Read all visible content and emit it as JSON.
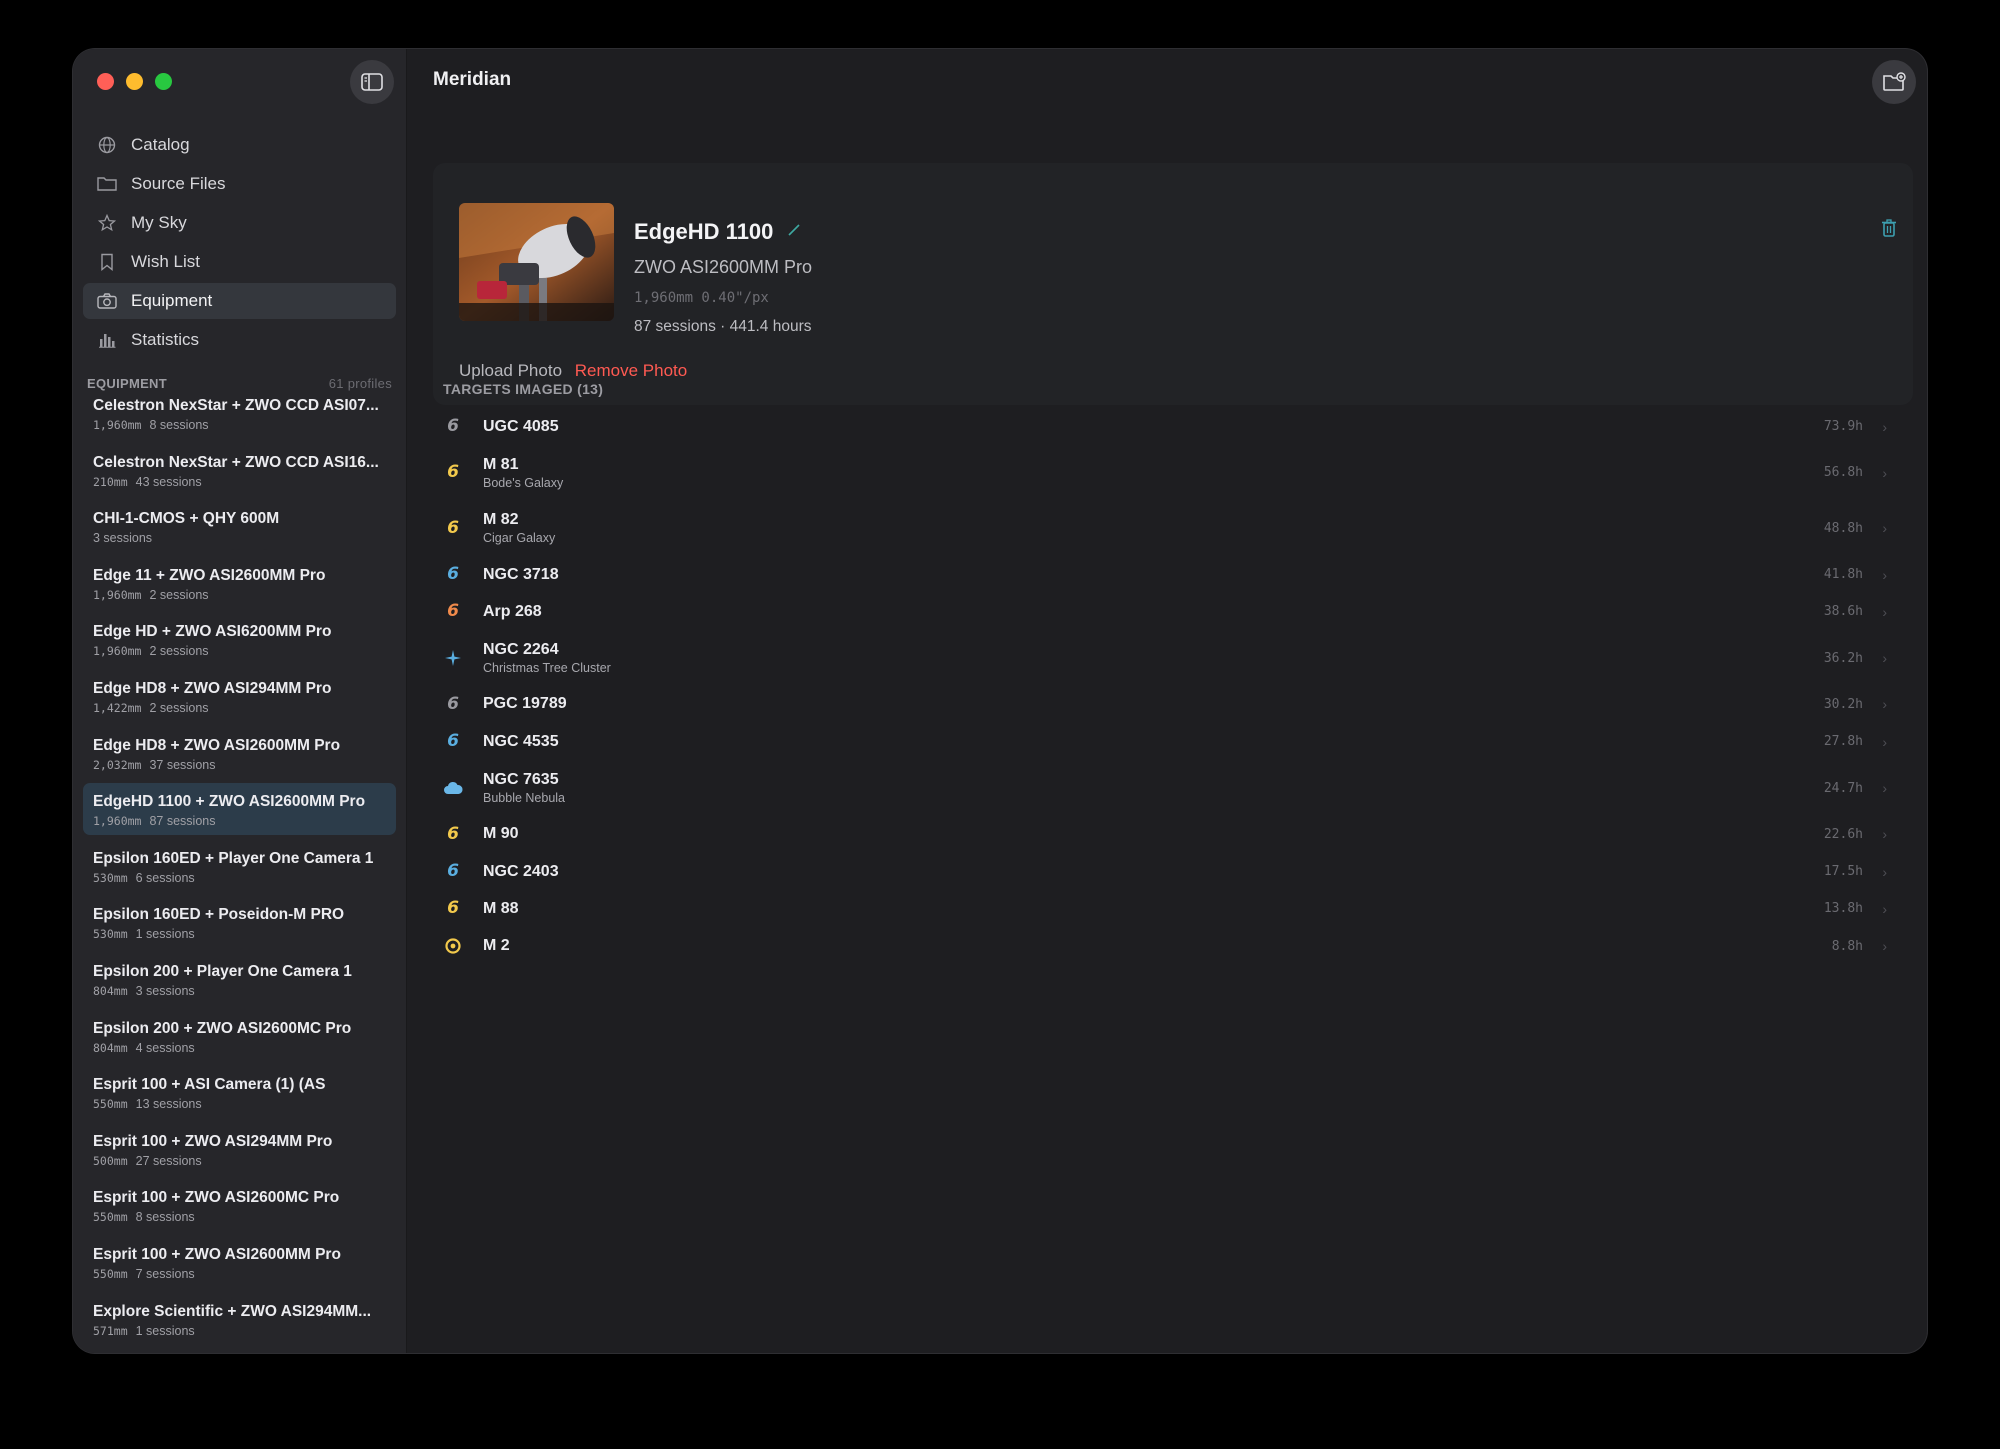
{
  "window": {
    "title": "Meridian"
  },
  "colors": {
    "accent_teal": "#3fa9a1",
    "danger": "#ff5a52",
    "selection": "#2c3c4a"
  },
  "nav": [
    {
      "label": "Catalog",
      "icon": "globe-icon"
    },
    {
      "label": "Source Files",
      "icon": "folder-icon"
    },
    {
      "label": "My Sky",
      "icon": "star-icon"
    },
    {
      "label": "Wish List",
      "icon": "bookmark-icon"
    },
    {
      "label": "Equipment",
      "icon": "camera-icon",
      "active": true
    },
    {
      "label": "Statistics",
      "icon": "bar-chart-icon"
    }
  ],
  "equipment_section": {
    "label": "EQUIPMENT",
    "count": "61 profiles"
  },
  "equipment": [
    {
      "name": "Celestron NexStar + ZWO CCD ASI07...",
      "focal": "1,960mm",
      "sessions": "8 sessions"
    },
    {
      "name": "Celestron NexStar + ZWO CCD ASI16...",
      "focal": "210mm",
      "sessions": "43 sessions"
    },
    {
      "name": "CHI-1-CMOS + QHY 600M",
      "focal": "",
      "sessions": "3 sessions"
    },
    {
      "name": "Edge 11 + ZWO ASI2600MM Pro",
      "focal": "1,960mm",
      "sessions": "2 sessions"
    },
    {
      "name": "Edge HD + ZWO ASI6200MM Pro",
      "focal": "1,960mm",
      "sessions": "2 sessions"
    },
    {
      "name": "Edge HD8 + ZWO ASI294MM Pro",
      "focal": "1,422mm",
      "sessions": "2 sessions"
    },
    {
      "name": "Edge HD8 + ZWO ASI2600MM Pro",
      "focal": "2,032mm",
      "sessions": "37 sessions"
    },
    {
      "name": "EdgeHD 1100 + ZWO ASI2600MM Pro",
      "focal": "1,960mm",
      "sessions": "87 sessions",
      "active": true
    },
    {
      "name": "Epsilon 160ED + Player One Camera 1",
      "focal": "530mm",
      "sessions": "6 sessions"
    },
    {
      "name": "Epsilon 160ED + Poseidon-M PRO",
      "focal": "530mm",
      "sessions": "1 sessions"
    },
    {
      "name": "Epsilon 200 + Player One Camera 1",
      "focal": "804mm",
      "sessions": "3 sessions"
    },
    {
      "name": "Epsilon 200 + ZWO ASI2600MC Pro",
      "focal": "804mm",
      "sessions": "4 sessions"
    },
    {
      "name": "Esprit 100 + ASI Camera (1) (AS",
      "focal": "550mm",
      "sessions": "13 sessions"
    },
    {
      "name": "Esprit 100 + ZWO ASI294MM Pro",
      "focal": "500mm",
      "sessions": "27 sessions"
    },
    {
      "name": "Esprit 100 + ZWO ASI2600MC Pro",
      "focal": "550mm",
      "sessions": "8 sessions"
    },
    {
      "name": "Esprit 100 + ZWO ASI2600MM Pro",
      "focal": "550mm",
      "sessions": "7 sessions"
    },
    {
      "name": "Explore Scientific + ZWO ASI294MM...",
      "focal": "571mm",
      "sessions": "1 sessions"
    }
  ],
  "detail": {
    "title": "EdgeHD 1100",
    "camera": "ZWO ASI2600MM Pro",
    "specs": "1,960mm  0.40\"/px",
    "stats": "87 sessions · 441.4 hours",
    "upload_label": "Upload Photo",
    "remove_label": "Remove Photo"
  },
  "targets_header": "TARGETS IMAGED (13)",
  "targets": [
    {
      "name": "UGC 4085",
      "sub": "",
      "hours": "73.9h",
      "icon": "galaxy-icon",
      "color": "#9a9aa0"
    },
    {
      "name": "M 81",
      "sub": "Bode's Galaxy",
      "hours": "56.8h",
      "icon": "galaxy-icon",
      "color": "#f2c94c"
    },
    {
      "name": "M 82",
      "sub": "Cigar Galaxy",
      "hours": "48.8h",
      "icon": "galaxy-icon",
      "color": "#f2c94c"
    },
    {
      "name": "NGC 3718",
      "sub": "",
      "hours": "41.8h",
      "icon": "galaxy-icon",
      "color": "#5aaee0"
    },
    {
      "name": "Arp 268",
      "sub": "",
      "hours": "38.6h",
      "icon": "galaxy-icon",
      "color": "#f08a4b"
    },
    {
      "name": "NGC 2264",
      "sub": "Christmas Tree Cluster",
      "hours": "36.2h",
      "icon": "sparkle-icon",
      "color": "#5aaee0"
    },
    {
      "name": "PGC 19789",
      "sub": "",
      "hours": "30.2h",
      "icon": "galaxy-icon",
      "color": "#9a9aa0"
    },
    {
      "name": "NGC 4535",
      "sub": "",
      "hours": "27.8h",
      "icon": "galaxy-icon",
      "color": "#5aaee0"
    },
    {
      "name": "NGC 7635",
      "sub": "Bubble Nebula",
      "hours": "24.7h",
      "icon": "cloud-icon",
      "color": "#6ab7e8"
    },
    {
      "name": "M 90",
      "sub": "",
      "hours": "22.6h",
      "icon": "galaxy-icon",
      "color": "#f2c94c"
    },
    {
      "name": "NGC 2403",
      "sub": "",
      "hours": "17.5h",
      "icon": "galaxy-icon",
      "color": "#5aaee0"
    },
    {
      "name": "M 88",
      "sub": "",
      "hours": "13.8h",
      "icon": "galaxy-icon",
      "color": "#f2c94c"
    },
    {
      "name": "M 2",
      "sub": "",
      "hours": "8.8h",
      "icon": "globular-cluster-icon",
      "color": "#f2c94c"
    }
  ]
}
